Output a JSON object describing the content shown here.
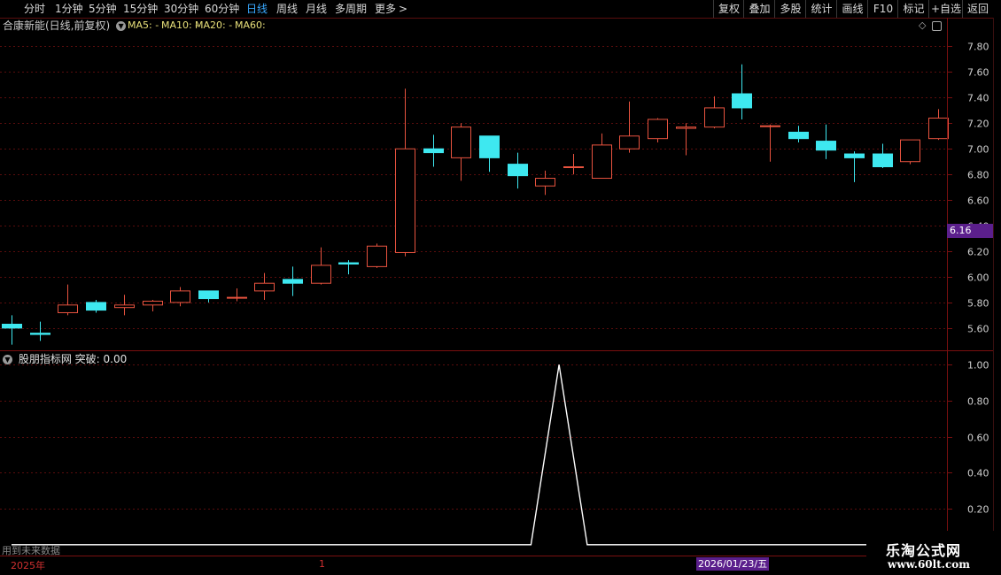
{
  "toolbar": {
    "periods": [
      "分时",
      "1分钟",
      "5分钟",
      "15分钟",
      "30分钟",
      "60分钟",
      "日线",
      "周线",
      "月线",
      "多周期",
      "更多"
    ],
    "active_period": "日线",
    "more_arrow": ">",
    "right_buttons": [
      "复权",
      "叠加",
      "多股",
      "统计",
      "画线",
      "F10",
      "标记",
      "+自选",
      "返回"
    ]
  },
  "main_panel": {
    "title": "合康新能(日线,前复权)",
    "ma_labels": [
      "MA5: -",
      "MA10: -",
      "MA20: -",
      "MA60:"
    ],
    "current_price_marker": "6.16"
  },
  "sub_panel": {
    "title": "股朋指标网",
    "indicator": "突破: 0.00"
  },
  "future_data_note": "用到未来数据",
  "x_axis": {
    "year_label": "2025年",
    "marker": "1",
    "cursor_date": "2026/01/23/五"
  },
  "watermark": {
    "line1": "乐淘公式网",
    "line2": "www.60lt.com"
  },
  "colors": {
    "up": "#e8533f",
    "down": "#3ee8f0",
    "grid": "#5a0d0d",
    "marker": "#5b1f8c",
    "active": "#39a9ff",
    "ma": "#e8e07a"
  },
  "chart_data": [
    {
      "type": "candlestick",
      "title": "合康新能(日线,前复权)",
      "y_ticks": [
        "7.80",
        "7.60",
        "7.40",
        "7.20",
        "7.00",
        "6.80",
        "6.60",
        "6.40",
        "6.20",
        "6.00",
        "5.80",
        "5.60"
      ],
      "ylim": [
        5.44,
        7.9
      ],
      "candles": [
        {
          "o": 5.63,
          "c": 5.6,
          "h": 5.7,
          "l": 5.47
        },
        {
          "o": 5.56,
          "c": 5.55,
          "h": 5.65,
          "l": 5.5
        },
        {
          "o": 5.72,
          "c": 5.78,
          "h": 5.94,
          "l": 5.7
        },
        {
          "o": 5.8,
          "c": 5.74,
          "h": 5.82,
          "l": 5.72
        },
        {
          "o": 5.76,
          "c": 5.78,
          "h": 5.86,
          "l": 5.7
        },
        {
          "o": 5.78,
          "c": 5.81,
          "h": 5.82,
          "l": 5.73
        },
        {
          "o": 5.8,
          "c": 5.89,
          "h": 5.92,
          "l": 5.77
        },
        {
          "o": 5.89,
          "c": 5.83,
          "h": 5.89,
          "l": 5.8
        },
        {
          "o": 5.84,
          "c": 5.84,
          "h": 5.91,
          "l": 5.81
        },
        {
          "o": 5.89,
          "c": 5.95,
          "h": 6.03,
          "l": 5.82
        },
        {
          "o": 5.98,
          "c": 5.95,
          "h": 6.08,
          "l": 5.85
        },
        {
          "o": 5.95,
          "c": 6.09,
          "h": 6.23,
          "l": 5.94
        },
        {
          "o": 6.11,
          "c": 6.1,
          "h": 6.13,
          "l": 6.02
        },
        {
          "o": 6.08,
          "c": 6.24,
          "h": 6.26,
          "l": 6.07
        },
        {
          "o": 6.19,
          "c": 7.0,
          "h": 7.47,
          "l": 6.16
        },
        {
          "o": 7.0,
          "c": 6.97,
          "h": 7.11,
          "l": 6.86
        },
        {
          "o": 6.93,
          "c": 7.17,
          "h": 7.2,
          "l": 6.75
        },
        {
          "o": 7.1,
          "c": 6.93,
          "h": 7.1,
          "l": 6.82
        },
        {
          "o": 6.88,
          "c": 6.79,
          "h": 6.97,
          "l": 6.69
        },
        {
          "o": 6.71,
          "c": 6.77,
          "h": 6.83,
          "l": 6.64
        },
        {
          "o": 6.86,
          "c": 6.86,
          "h": 6.96,
          "l": 6.8
        },
        {
          "o": 6.77,
          "c": 7.03,
          "h": 7.12,
          "l": 6.77
        },
        {
          "o": 7.0,
          "c": 7.1,
          "h": 7.37,
          "l": 6.97
        },
        {
          "o": 7.08,
          "c": 7.23,
          "h": 7.24,
          "l": 7.05
        },
        {
          "o": 7.16,
          "c": 7.17,
          "h": 7.2,
          "l": 6.95
        },
        {
          "o": 7.17,
          "c": 7.32,
          "h": 7.41,
          "l": 7.16
        },
        {
          "o": 7.43,
          "c": 7.32,
          "h": 7.66,
          "l": 7.23
        },
        {
          "o": 7.18,
          "c": 7.18,
          "h": 7.19,
          "l": 6.9
        },
        {
          "o": 7.13,
          "c": 7.08,
          "h": 7.18,
          "l": 7.05
        },
        {
          "o": 7.06,
          "c": 6.99,
          "h": 7.19,
          "l": 6.92
        },
        {
          "o": 6.96,
          "c": 6.93,
          "h": 6.98,
          "l": 6.74
        },
        {
          "o": 6.96,
          "c": 6.86,
          "h": 7.04,
          "l": 6.85
        },
        {
          "o": 6.9,
          "c": 7.07,
          "h": 7.07,
          "l": 6.88
        },
        {
          "o": 7.08,
          "c": 7.24,
          "h": 7.31,
          "l": 7.07
        }
      ]
    },
    {
      "type": "line",
      "title": "股朋指标网 突破",
      "y_ticks": [
        "1.00",
        "0.80",
        "0.60",
        "0.40",
        "0.20"
      ],
      "ylim": [
        -0.05,
        1.05
      ],
      "points": [
        {
          "x": 0,
          "y": 0
        },
        {
          "x": 18.5,
          "y": 0
        },
        {
          "x": 19.5,
          "y": 1
        },
        {
          "x": 20.5,
          "y": 0
        },
        {
          "x": 33.5,
          "y": 0
        }
      ]
    }
  ]
}
